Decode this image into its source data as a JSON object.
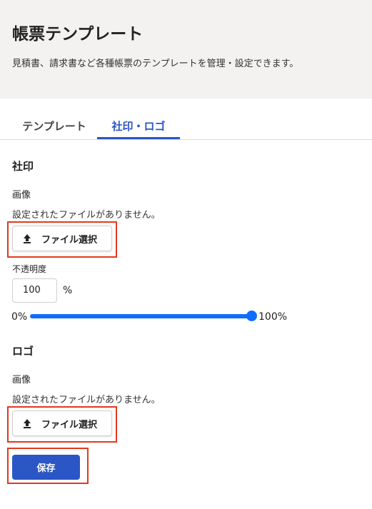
{
  "header": {
    "title": "帳票テンプレート",
    "description": "見積書、請求書など各種帳票のテンプレートを管理・設定できます。"
  },
  "tabs": [
    {
      "label": "テンプレート",
      "active": false
    },
    {
      "label": "社印・ロゴ",
      "active": true
    }
  ],
  "seal": {
    "title": "社印",
    "image_label": "画像",
    "no_file_text": "設定されたファイルがありません。",
    "file_button_label": "ファイル選択",
    "opacity_label": "不透明度",
    "opacity_value": "100",
    "opacity_unit": "%",
    "slider_min_label": "0%",
    "slider_max_label": "100%",
    "slider_value_percent": 100
  },
  "logo": {
    "title": "ロゴ",
    "image_label": "画像",
    "no_file_text": "設定されたファイルがありません。",
    "file_button_label": "ファイル選択"
  },
  "save_label": "保存",
  "colors": {
    "accent": "#2a56c6",
    "slider": "#0d6efd",
    "highlight": "#e2391d",
    "header_bg": "#f3f2f1"
  },
  "icons": {
    "upload": "upload-icon"
  }
}
